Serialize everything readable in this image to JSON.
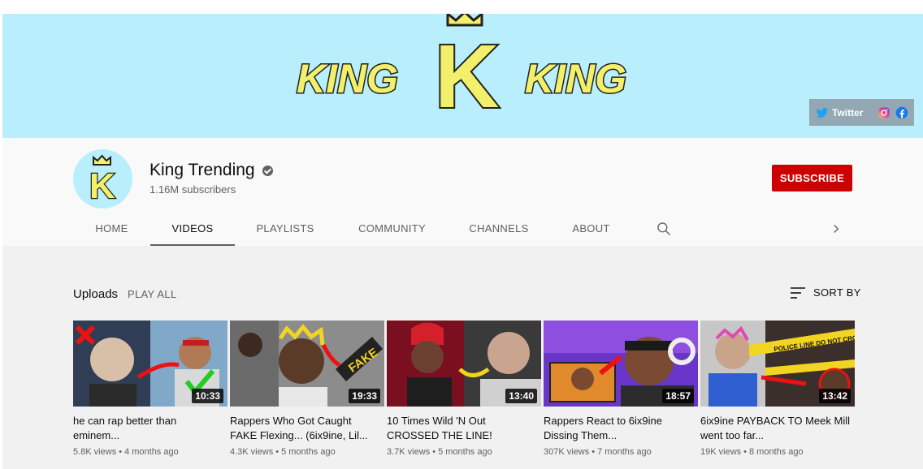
{
  "banner": {
    "logo_text_left": "KING",
    "logo_text_right": "KING",
    "logo_letter": "K",
    "links": {
      "twitter_label": "Twitter"
    }
  },
  "channel": {
    "name": "King Trending",
    "subscribers": "1.16M subscribers",
    "subscribe_label": "SUBSCRIBE",
    "avatar_letter": "K"
  },
  "tabs": [
    {
      "label": "HOME"
    },
    {
      "label": "VIDEOS"
    },
    {
      "label": "PLAYLISTS"
    },
    {
      "label": "COMMUNITY"
    },
    {
      "label": "CHANNELS"
    },
    {
      "label": "ABOUT"
    }
  ],
  "uploads": {
    "title": "Uploads",
    "play_all": "PLAY ALL",
    "sort_by": "SORT BY"
  },
  "videos": [
    {
      "title": "he can rap better than eminem...",
      "views": "5.8K views",
      "age": "4 months ago",
      "duration": "10:33"
    },
    {
      "title": "Rappers Who Got Caught FAKE Flexing... (6ix9ine, Lil...",
      "views": "4.3K views",
      "age": "5 months ago",
      "duration": "19:33",
      "thumb_text": "FAKE"
    },
    {
      "title": "10 Times Wild 'N Out CROSSED THE LINE!",
      "views": "3.7K views",
      "age": "5 months ago",
      "duration": "13:40"
    },
    {
      "title": "Rappers React to 6ix9ine Dissing Them...",
      "views": "307K views",
      "age": "7 months ago",
      "duration": "18:57"
    },
    {
      "title": "6ix9ine PAYBACK TO Meek Mill went too far...",
      "views": "19K views",
      "age": "8 months ago",
      "duration": "13:42",
      "thumb_text": "POLICE LINE DO NOT CROSS"
    }
  ],
  "colors": {
    "banner_bg": "#b9eefc",
    "subscribe_red": "#cc0000",
    "logo_yellow": "#f2ef6a"
  }
}
